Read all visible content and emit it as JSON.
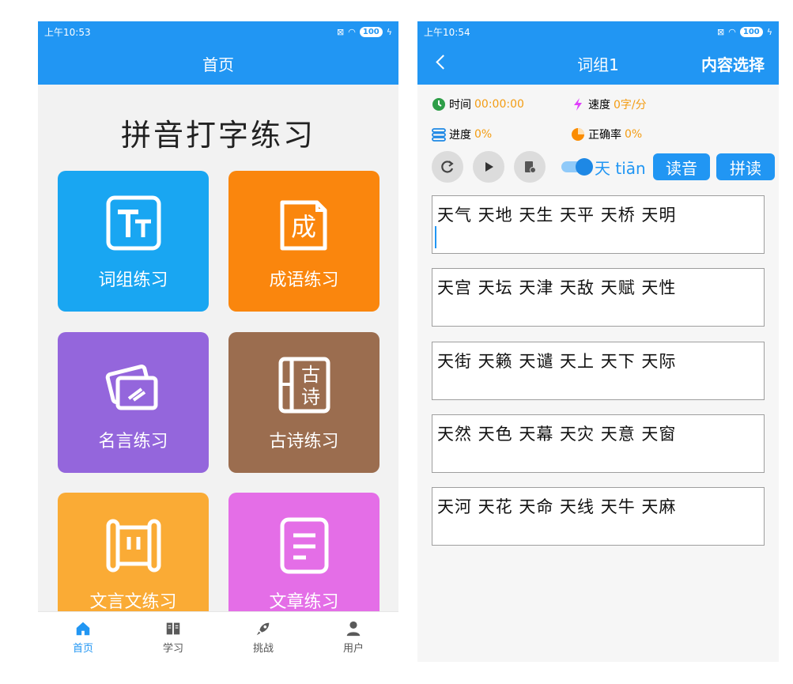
{
  "left": {
    "status": {
      "time": "上午10:53",
      "battery": "100"
    },
    "title": "首页",
    "app_title": "拼音打字练习",
    "tiles": [
      {
        "label": "词组练习",
        "icon": "text-size-icon",
        "color": "#19a6f2"
      },
      {
        "label": "成语练习",
        "icon": "idiom-book-icon",
        "icon_text": "成",
        "color": "#fa860d"
      },
      {
        "label": "名言练习",
        "icon": "cards-icon",
        "color": "#9466dc"
      },
      {
        "label": "古诗练习",
        "icon": "poem-book-icon",
        "icon_text_1": "古",
        "icon_text_2": "诗",
        "color": "#9b6d4f"
      },
      {
        "label": "文言文练习",
        "icon": "scroll-icon",
        "color": "#faab35"
      },
      {
        "label": "文章练习",
        "icon": "document-icon",
        "color": "#e46ee7"
      }
    ],
    "nav": [
      {
        "label": "首页",
        "icon": "home-icon",
        "active": true
      },
      {
        "label": "学习",
        "icon": "book-icon"
      },
      {
        "label": "挑战",
        "icon": "rocket-icon"
      },
      {
        "label": "用户",
        "icon": "user-icon"
      }
    ]
  },
  "right": {
    "status": {
      "time": "上午10:54",
      "battery": "100"
    },
    "title": "词组1",
    "content_select": "内容选择",
    "stats": {
      "time_label": "时间",
      "time_value": "00:00:00",
      "speed_label": "速度",
      "speed_value": "0字/分",
      "progress_label": "进度",
      "progress_value": "0%",
      "accuracy_label": "正确率",
      "accuracy_value": "0%"
    },
    "pinyin_char": "天",
    "pinyin": "tiān",
    "read_button": "读音",
    "spell_button": "拼读",
    "words": [
      "天气 天地 天生 天平 天桥 天明",
      "天宫 天坛 天津 天敌 天赋 天性",
      "天街 天籁 天谴 天上 天下 天际",
      "天然 天色 天幕 天灾 天意 天窗",
      "天河 天花 天命 天线 天牛 天麻"
    ]
  },
  "colors": {
    "primary": "#2196f3",
    "accent_orange": "#f39c12"
  }
}
